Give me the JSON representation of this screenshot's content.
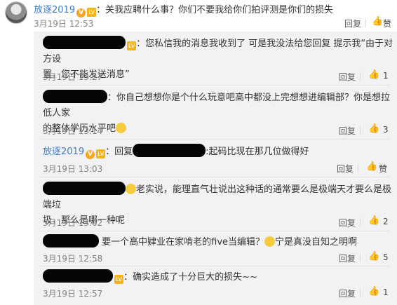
{
  "main": {
    "username": "放逐2019",
    "badge_text": "V",
    "level": "LV",
    "text": "：关我应聘什么事？你们不要我给你们拍评测是你们的损失",
    "time": "3月19日 12:53",
    "reply_label": "回复",
    "like_label": "赞"
  },
  "replies": [
    {
      "line1": "：您私信我的消息我收到了 可是我没法给您回复 提示我“由于对方设",
      "line2": "置，您不能发送消息”",
      "time": "3月19日 13:27",
      "reply_label": "回复",
      "likes": "1"
    },
    {
      "line1": "：你自己想想你是个什么玩意吧高中都没上完想想进编辑部？你是想拉低人家",
      "line2": "的整体学历水平吧",
      "time": "3月19日 13:14",
      "reply_label": "回复",
      "likes": "3"
    },
    {
      "username": "放逐2019",
      "prefix": "：回复",
      "line1": ":起码比现在那几位做得好",
      "time": "3月19日 13:03",
      "reply_label": "回复",
      "likes": "赞"
    },
    {
      "line1": "老实说，能理直气壮说出这种话的通常要么是极端天才要么是极端垃",
      "line2": "圾，那么是哪一种呢",
      "time": "3月19日 13:02",
      "reply_label": "回复",
      "likes": "2"
    },
    {
      "line1": "要一个高中肄业在家啃老的five当编辑？",
      "line1b": "宁是真没自知之明啊",
      "time": "3月19日 12:58",
      "reply_label": "回复",
      "likes": "5"
    },
    {
      "line1": "：确实造成了十分巨大的损失~~",
      "time": "3月19日 12:57",
      "reply_label": "回复",
      "likes": "1"
    }
  ],
  "icons": {
    "thumb": "thumbs-up-icon",
    "verified": "verified-v-icon",
    "level": "level-badge-icon",
    "emoji": "emoji-face-icon"
  },
  "colors": {
    "username": "#3d7cc7",
    "list_bg": "#f2f2f5",
    "verified": "#f5a623"
  }
}
